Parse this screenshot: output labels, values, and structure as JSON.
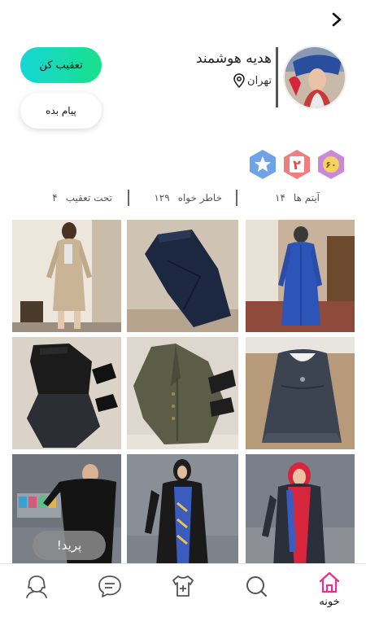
{
  "header": {
    "back_icon": "chevron-right-icon"
  },
  "profile": {
    "name": "هدیه هوشمند",
    "location": "تهران",
    "location_icon": "map-pin-icon",
    "follow_label": "تعقیب کن",
    "message_label": "پیام بده"
  },
  "badges": [
    {
      "icon": "gold-hexagon-badge",
      "text": "۶۰",
      "color": "#c88ad8"
    },
    {
      "icon": "level-hexagon-badge",
      "text": "۲",
      "color": "#f07e7e"
    },
    {
      "icon": "star-hexagon-badge",
      "text": "",
      "color": "#6fa3e6"
    }
  ],
  "stats": [
    {
      "label": "آیتم ها",
      "value": "۱۴"
    },
    {
      "label": "خاطر خواه",
      "value": "۱۲۹"
    },
    {
      "label": "تحت تعقیب",
      "value": "۴"
    }
  ],
  "grid_items": [
    "blue-dress-item",
    "navy-skirt-item",
    "beige-dress-item",
    "grey-dress-item",
    "olive-coat-item",
    "black-dress-item",
    "red-scarf-item",
    "black-manteau-item",
    "black-abaya-item"
  ],
  "toast": {
    "text": "پرید!"
  },
  "nav": [
    {
      "icon": "home-icon",
      "label": "خونه",
      "active": true,
      "color": "#e6318f"
    },
    {
      "icon": "search-icon",
      "label": ""
    },
    {
      "icon": "add-item-icon",
      "label": ""
    },
    {
      "icon": "chat-icon",
      "label": ""
    },
    {
      "icon": "profile-icon",
      "label": ""
    }
  ]
}
